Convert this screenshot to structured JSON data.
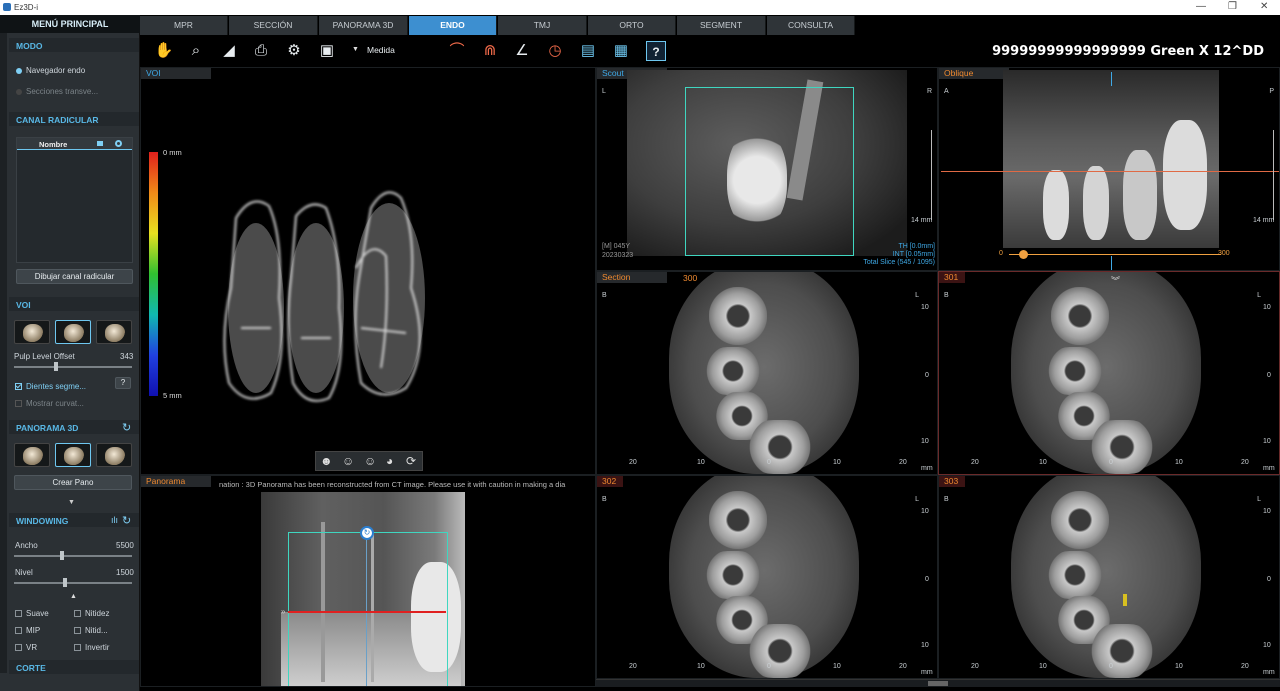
{
  "window": {
    "title": "Ez3D-i",
    "minimize": "—",
    "maximize": "❐",
    "close": "✕"
  },
  "sidebar": {
    "header": "MENÚ PRINCIPAL",
    "modo": {
      "title": "MODO",
      "options": [
        "Navegador endo",
        "Secciones transve..."
      ]
    },
    "canal": {
      "title": "CANAL RADICULAR",
      "column": "Nombre",
      "button": "Dibujar canal radicular"
    },
    "voi": {
      "title": "VOI",
      "pulp_label": "Pulp Level Offset",
      "pulp_value": "343",
      "pulp_level": 0.35,
      "chk_dientes": "Dientes segme...",
      "chk_mostrar": "Mostrar curvat...",
      "help": "?"
    },
    "panorama": {
      "title": "PANORAMA 3D",
      "button": "Crear Pano"
    },
    "windowing": {
      "title": "WINDOWING",
      "ancho_label": "Ancho",
      "ancho_value": "5500",
      "ancho_level": 0.4,
      "nivel_label": "Nivel",
      "nivel_value": "1500",
      "nivel_level": 0.43,
      "options": [
        "Suave",
        "Nitidez",
        "MIP",
        "Nitid...",
        "VR",
        "Invertir"
      ]
    },
    "corte": {
      "title": "CORTE"
    }
  },
  "tabs": [
    {
      "label": "MPR"
    },
    {
      "label": "SECCIÓN"
    },
    {
      "label": "PANORAMA 3D"
    },
    {
      "label": "ENDO"
    },
    {
      "label": "TMJ"
    },
    {
      "label": "ORTO"
    },
    {
      "label": "SEGMENT"
    },
    {
      "label": "CONSULTA"
    }
  ],
  "toolbar": {
    "medida": "Medida",
    "patient": "99999999999999999 Green X 12^DD"
  },
  "voi_view": {
    "label": "VOI",
    "scale_top": "0 mm",
    "scale_bottom": "5 mm"
  },
  "scout": {
    "label": "Scout",
    "left": "L",
    "right": "R",
    "scale": "14 mm",
    "patient_info": "[M] 045Y",
    "date": "20230323",
    "th": "TH [0.0mm]",
    "int": "INT [0.05mm]",
    "slices": "Total Slice (545 / 1095)"
  },
  "oblique": {
    "label": "Oblique",
    "left": "A",
    "right": "P",
    "scale": "14 mm",
    "range_min": "0",
    "range_max": "300",
    "range_level": 0.05
  },
  "panorama_view": {
    "label": "Panorama",
    "notice": "nation : 3D Panorama has been reconstructed from CT image. Please use it with caution in making a dia"
  },
  "sections": [
    {
      "label": "Section",
      "index": "300",
      "left": "B",
      "right": "L",
      "axis": [
        "20",
        "10",
        "0",
        "10",
        "20"
      ],
      "vertical": [
        "10",
        "0",
        "10"
      ],
      "unit": "mm"
    },
    {
      "label": "301",
      "left": "B",
      "right": "L",
      "axis": [
        "20",
        "10",
        "0",
        "10",
        "20"
      ],
      "vertical": [
        "10",
        "0",
        "10"
      ],
      "unit": "mm"
    },
    {
      "label": "302",
      "left": "B",
      "right": "L",
      "axis": [
        "20",
        "10",
        "0",
        "10",
        "20"
      ],
      "vertical": [
        "10",
        "0",
        "10"
      ],
      "unit": "mm"
    },
    {
      "label": "303",
      "left": "B",
      "right": "L",
      "axis": [
        "20",
        "10",
        "0",
        "10",
        "20"
      ],
      "vertical": [
        "10",
        "0",
        "10"
      ],
      "unit": "mm"
    }
  ],
  "colors": {
    "accent": "#3d8fd0",
    "label_blue": "#3fa9e6",
    "orange": "#f08a30",
    "panel": "#2b3034"
  }
}
